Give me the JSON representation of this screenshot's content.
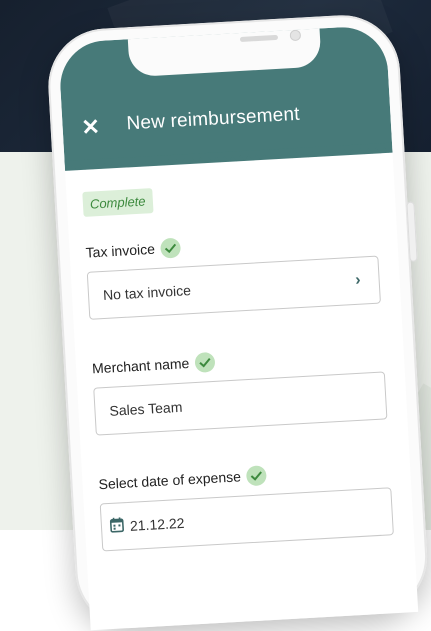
{
  "header": {
    "title": "New reimbursement",
    "close_icon": "close-icon",
    "color": "#477a79"
  },
  "status": {
    "badge": "Complete"
  },
  "fields": {
    "tax_invoice": {
      "label": "Tax invoice",
      "value": "No tax invoice"
    },
    "merchant_name": {
      "label": "Merchant name",
      "value": "Sales Team"
    },
    "expense_date": {
      "label": "Select date of expense",
      "value": "21.12.22"
    }
  }
}
